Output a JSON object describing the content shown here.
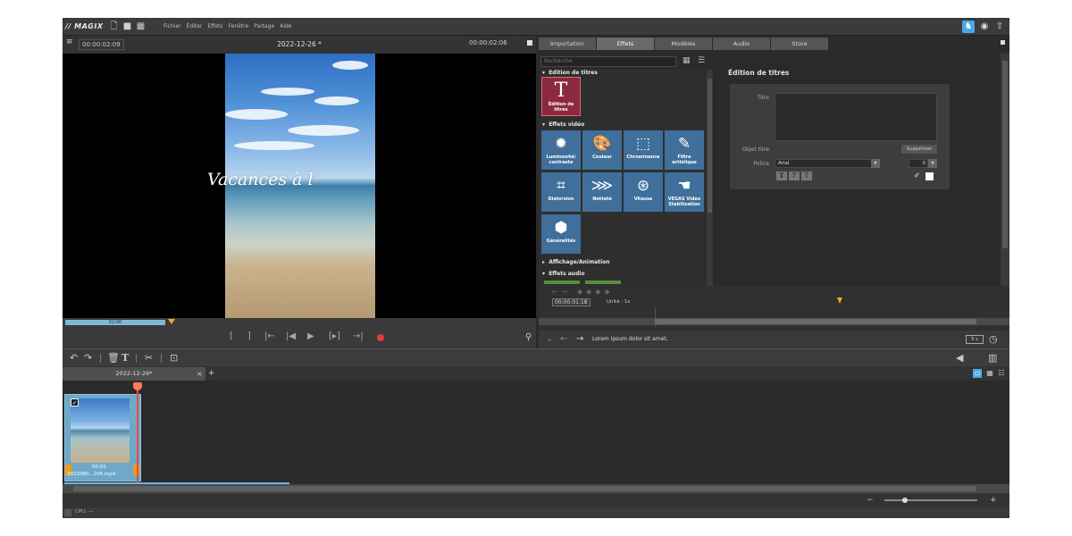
{
  "app": {
    "logo": "MAGIX",
    "menu": [
      "Fichier",
      "Éditer",
      "Effets",
      "Fenêtre",
      "Partage",
      "Aide"
    ]
  },
  "preview": {
    "timecode_left": "00:00:02:09",
    "project_title": "2022-12-26 *",
    "timecode_right": "00:00:02:06",
    "overlay_text": "Vacances à l",
    "scrub_label": "02:06"
  },
  "tabs": [
    {
      "label": "Importation",
      "active": false
    },
    {
      "label": "Effets",
      "active": true
    },
    {
      "label": "Modèles",
      "active": false
    },
    {
      "label": "Audio",
      "active": false
    },
    {
      "label": "Store",
      "active": false
    }
  ],
  "effects": {
    "search_placeholder": "Recherche",
    "sections": {
      "titles": "Édition de titres",
      "video": "Effets vidéo",
      "display": "Affichage/Animation",
      "audio": "Effets audio"
    },
    "title_tile": "Édition de titres",
    "tiles": [
      "Luminosité/ contraste",
      "Couleur",
      "Chrominance",
      "Filtre artistique",
      "Distorsion",
      "Netteté",
      "Vitesse",
      "VEGAS Video Stabilization",
      "Généralités"
    ]
  },
  "title_editor": {
    "heading": "Édition de titres",
    "title_label": "Titre",
    "object_label": "Objet titre",
    "delete_label": "Supprimer",
    "font_label": "Police",
    "font_value": "Arial",
    "size_value": "0",
    "format_buttons": [
      "T",
      "T",
      "T"
    ]
  },
  "mini_timeline": {
    "timecode": "00:00:01:18",
    "unit_label": "Unité : 1s"
  },
  "status": {
    "message": "Lorem ipsum dolor sit amet,",
    "zoom_value": "5 s"
  },
  "project_tab": {
    "label": "2022-12-26*",
    "close": "×",
    "add": "+"
  },
  "clip": {
    "duration": "00:02",
    "name": "2022060...205.mp4"
  },
  "cpu": {
    "label": "CPU: —"
  },
  "colors": {
    "accent_blue": "#4aa8e8",
    "fx_tile": "#3f6f9a",
    "title_tile": "#8b2a3e",
    "record_red": "#e53935",
    "marker_orange": "#f5a623"
  }
}
